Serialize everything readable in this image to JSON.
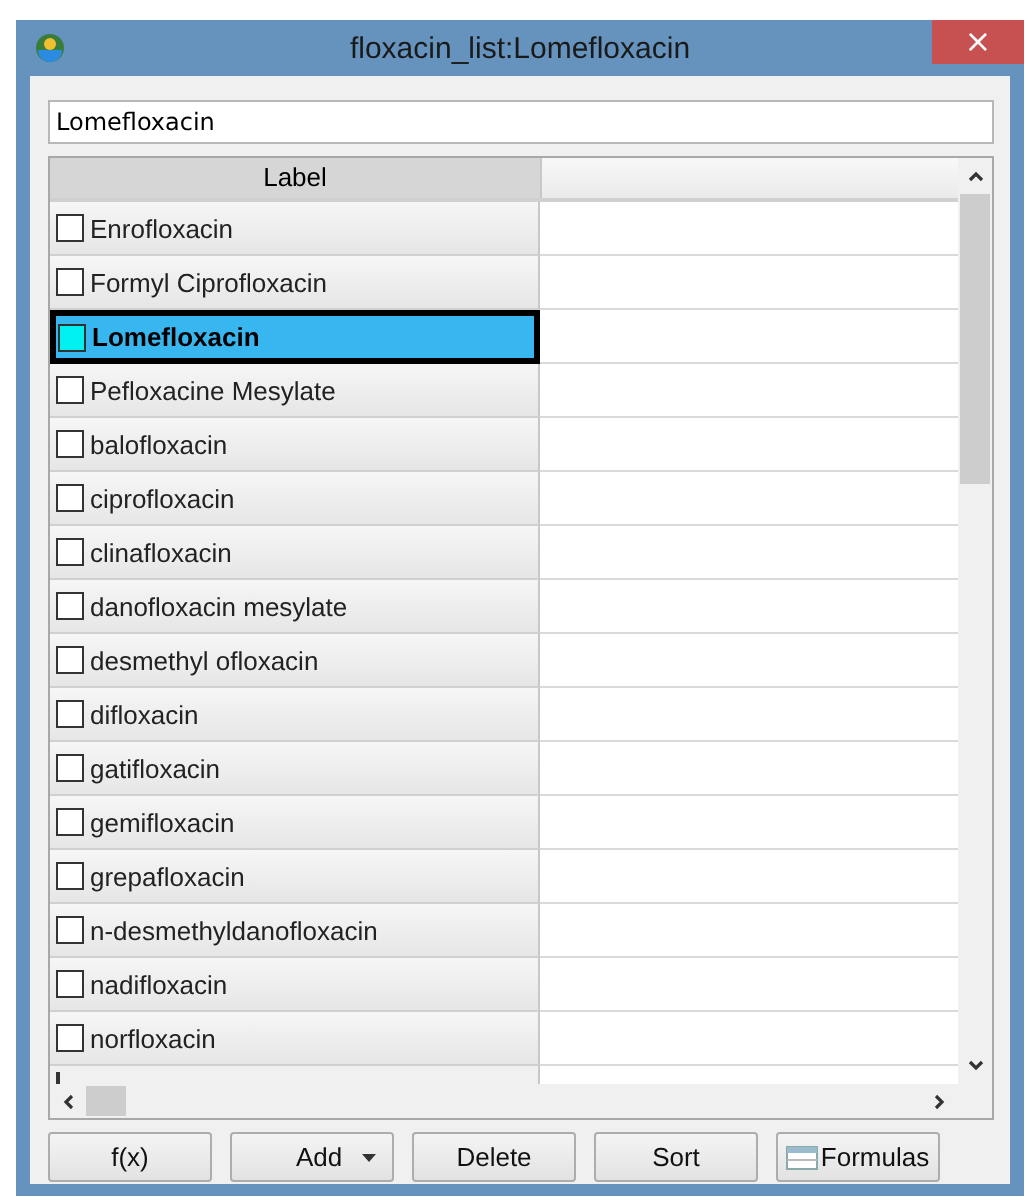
{
  "window": {
    "title": "floxacin_list:Lomefloxacin",
    "close": "×"
  },
  "name_field": {
    "value": "Lomefloxacin"
  },
  "table": {
    "columns": [
      "Label"
    ],
    "rows": [
      {
        "label": "Enrofloxacin",
        "selected": false
      },
      {
        "label": "Formyl Ciprofloxacin",
        "selected": false
      },
      {
        "label": "Lomefloxacin",
        "selected": true
      },
      {
        "label": "Pefloxacine Mesylate",
        "selected": false
      },
      {
        "label": "balofloxacin",
        "selected": false
      },
      {
        "label": "ciprofloxacin",
        "selected": false
      },
      {
        "label": "clinafloxacin",
        "selected": false
      },
      {
        "label": "danofloxacin mesylate",
        "selected": false
      },
      {
        "label": "desmethyl ofloxacin",
        "selected": false
      },
      {
        "label": "difloxacin",
        "selected": false
      },
      {
        "label": "gatifloxacin",
        "selected": false
      },
      {
        "label": "gemifloxacin",
        "selected": false
      },
      {
        "label": "grepafloxacin",
        "selected": false
      },
      {
        "label": "n-desmethyldanofloxacin",
        "selected": false
      },
      {
        "label": "nadifloxacin",
        "selected": false
      },
      {
        "label": "norfloxacin",
        "selected": false
      }
    ]
  },
  "buttons": [
    {
      "label": "f(x)",
      "kind": "plain"
    },
    {
      "label": "Add",
      "kind": "dropdown"
    },
    {
      "label": "Delete",
      "kind": "plain"
    },
    {
      "label": "Sort",
      "kind": "plain"
    },
    {
      "label": "Formulas",
      "kind": "icon"
    }
  ]
}
